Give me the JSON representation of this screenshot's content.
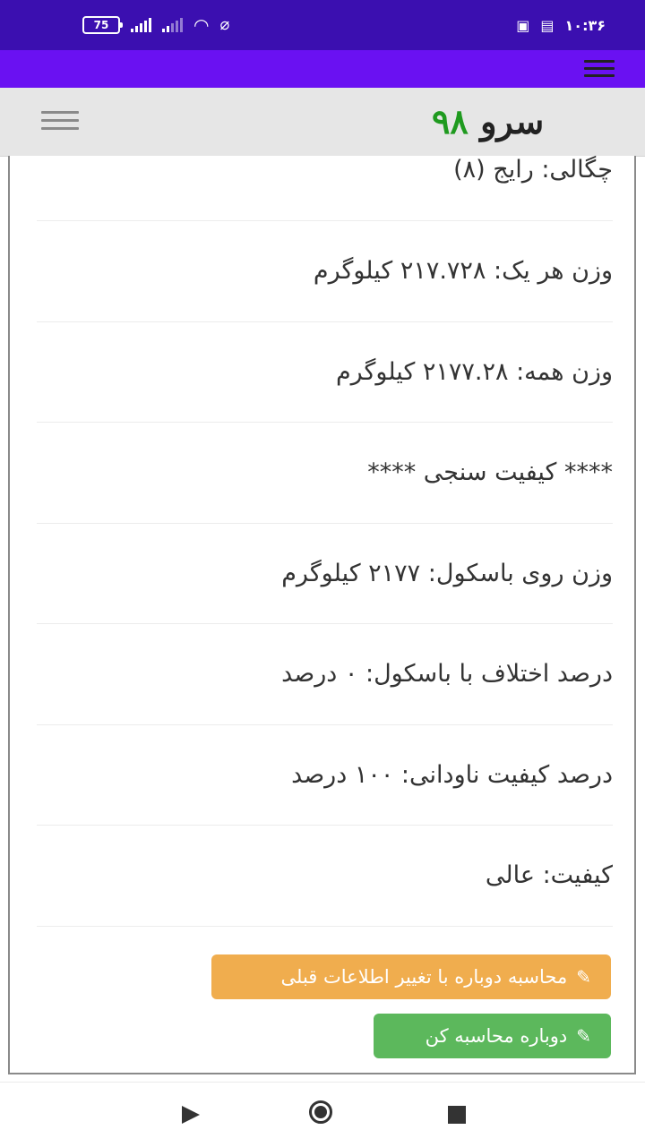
{
  "status_bar": {
    "battery": "75",
    "time": "۱۰:۳۶",
    "icons": [
      "battery-icon",
      "signal-icon",
      "signal-icon",
      "wifi-icon",
      "bell-off-icon",
      "notification-icon",
      "trash-icon"
    ]
  },
  "header": {
    "brand_text": "سرو",
    "brand_number": "۹۸",
    "brand_colors": {
      "text": "#222222",
      "number": "#1f9a1f"
    }
  },
  "colors": {
    "status_bar": "#3b0fb0",
    "app_bar": "#6a11f2",
    "button_orange": "#f0ad4e",
    "button_green": "#5cb85c"
  },
  "results": [
    {
      "text": "چگالی: رایج (۸)"
    },
    {
      "text": "وزن هر یک: ۲۱۷.۷۲۸ کیلوگرم"
    },
    {
      "text": "وزن همه: ۲۱۷۷.۲۸ کیلوگرم"
    },
    {
      "text": "**** کیفیت سنجی ****"
    },
    {
      "text": "وزن روی باسکول: ۲۱۷۷ کیلوگرم"
    },
    {
      "text": "درصد اختلاف با باسکول: ۰ درصد"
    },
    {
      "text": "درصد کیفیت ناودانی: ۱۰۰ درصد"
    },
    {
      "text": "کیفیت: عالی"
    }
  ],
  "buttons": {
    "recalc_with_previous": "محاسبه دوباره با تغییر اطلاعات قبلی",
    "recalc": "دوباره محاسبه کن"
  }
}
